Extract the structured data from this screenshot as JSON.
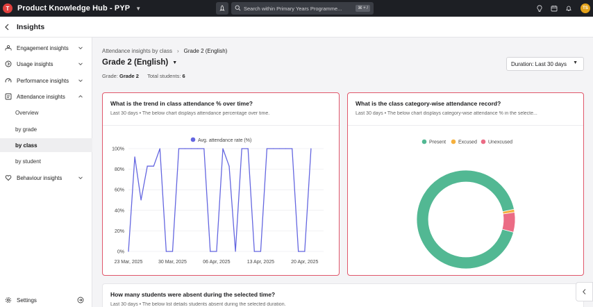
{
  "topbar": {
    "logo_text": "T",
    "app_title": "Product Knowledge Hub - PYP",
    "search_placeholder": "Search within Primary Years Programme...",
    "search_shortcut": "⌘ + /",
    "avatar_initials": "TS"
  },
  "subheader": {
    "title": "Insights"
  },
  "sidebar": {
    "items": [
      {
        "label": "Engagement insights"
      },
      {
        "label": "Usage insights"
      },
      {
        "label": "Performance insights"
      },
      {
        "label": "Attendance insights"
      }
    ],
    "attendance_subitems": [
      {
        "label": "Overview"
      },
      {
        "label": "by grade"
      },
      {
        "label": "by class",
        "active": true
      },
      {
        "label": "by student"
      }
    ],
    "behaviour": {
      "label": "Behaviour insights"
    },
    "settings": {
      "label": "Settings"
    }
  },
  "breadcrumb": {
    "parent": "Attendance insights by class",
    "current": "Grade 2 (English)"
  },
  "page": {
    "title": "Grade 2 (English)",
    "grade_label": "Grade:",
    "grade_value": "Grade 2",
    "students_label": "Total students:",
    "students_value": "6"
  },
  "duration": {
    "label": "Duration: Last 30 days"
  },
  "cards": {
    "trend": {
      "title": "What is the trend in class attendance % over time?",
      "subtitle": "Last 30 days  •  The below chart displays attendance percentage over time."
    },
    "category": {
      "title": "What is the class category-wise attendance record?",
      "subtitle": "Last 30 days  •  The below chart displays category-wise attendance % in the selecte..."
    },
    "absent": {
      "title": "How many students were absent during the selected time?",
      "subtitle": "Last 30 days  •  The below list details students absent during the selected duration."
    }
  },
  "colors": {
    "accent": "#6466e0",
    "present": "#52b893",
    "excused": "#f5b03d",
    "unexcused": "#eb6c85",
    "card_border": "#e0566a"
  },
  "chart_data": [
    {
      "type": "line",
      "title": "",
      "xlabel": "",
      "ylabel": "",
      "legend": "top",
      "ylim": [
        0,
        100
      ],
      "yticks": [
        "0%",
        "20%",
        "40%",
        "60%",
        "80%",
        "100%"
      ],
      "x_ticks": [
        "23 Mar, 2025",
        "30 Mar, 2025",
        "06 Apr, 2025",
        "13 Apr, 2025",
        "20 Apr, 2025"
      ],
      "x_range_days": [
        0,
        31
      ],
      "series": [
        {
          "name": "Avg. attendance rate (%)",
          "color": "#6466e0",
          "points": [
            [
              0,
              0
            ],
            [
              1,
              92
            ],
            [
              2,
              50
            ],
            [
              3,
              83
            ],
            [
              4,
              83
            ],
            [
              5,
              100
            ],
            [
              6,
              0
            ],
            [
              7,
              0
            ],
            [
              8,
              100
            ],
            [
              9,
              100
            ],
            [
              10,
              100
            ],
            [
              11,
              100
            ],
            [
              12,
              100
            ],
            [
              13,
              0
            ],
            [
              14,
              0
            ],
            [
              15,
              100
            ],
            [
              16,
              83
            ],
            [
              17,
              0
            ],
            [
              18,
              100
            ],
            [
              19,
              100
            ],
            [
              20,
              0
            ],
            [
              21,
              0
            ],
            [
              22,
              100
            ],
            [
              23,
              100
            ],
            [
              24,
              100
            ],
            [
              25,
              100
            ],
            [
              26,
              100
            ],
            [
              27,
              0
            ],
            [
              28,
              0
            ],
            [
              29,
              100
            ]
          ]
        }
      ]
    },
    {
      "type": "pie",
      "title": "",
      "legend": "top",
      "donut": true,
      "slices": [
        {
          "name": "Present",
          "value": 92.5,
          "color": "#52b893"
        },
        {
          "name": "Excused",
          "value": 1,
          "color": "#f5b03d"
        },
        {
          "name": "Unexcused",
          "value": 6.5,
          "color": "#eb6c85"
        }
      ]
    }
  ]
}
